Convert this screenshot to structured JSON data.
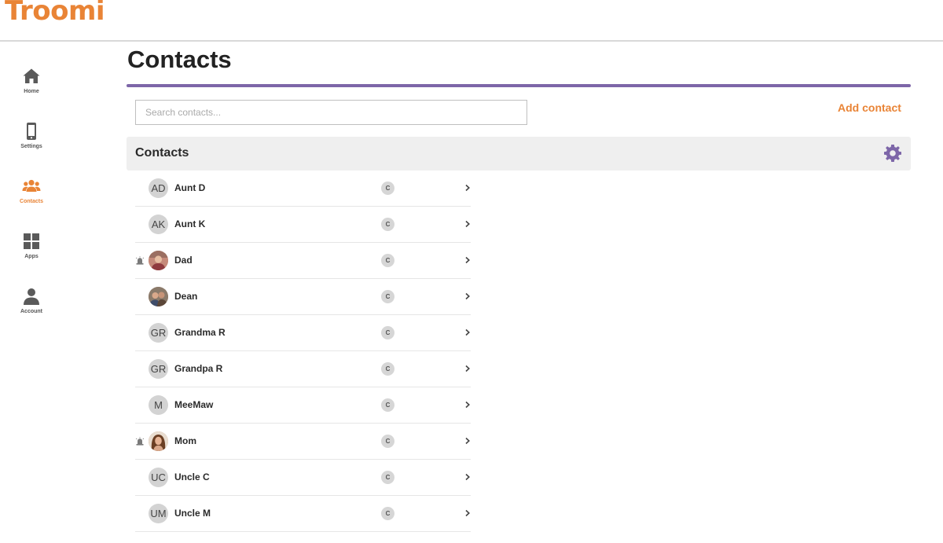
{
  "app": {
    "logo_text": "Troomi",
    "logo_mark": "™",
    "brand_color": "#e98436",
    "accent_color": "#7d66a8"
  },
  "sidebar": {
    "items": [
      {
        "label": "Home",
        "icon": "home-icon",
        "active": false
      },
      {
        "label": "Settings",
        "icon": "phone-icon",
        "active": false
      },
      {
        "label": "Contacts",
        "icon": "users-icon",
        "active": true
      },
      {
        "label": "Apps",
        "icon": "grid-icon",
        "active": false
      },
      {
        "label": "Account",
        "icon": "user-icon",
        "active": false
      }
    ]
  },
  "page": {
    "title": "Contacts",
    "search_placeholder": "Search contacts...",
    "search_value": "",
    "add_contact_label": "Add contact",
    "section_title": "Contacts",
    "settings_icon": "gear-icon"
  },
  "contacts": [
    {
      "name": "Aunt D",
      "initials": "AD",
      "photo": false,
      "alert": false,
      "badge": "C"
    },
    {
      "name": "Aunt K",
      "initials": "AK",
      "photo": false,
      "alert": false,
      "badge": "C"
    },
    {
      "name": "Dad",
      "initials": "",
      "photo": true,
      "alert": true,
      "badge": "C"
    },
    {
      "name": "Dean",
      "initials": "",
      "photo": true,
      "alert": false,
      "badge": "C"
    },
    {
      "name": "Grandma R",
      "initials": "GR",
      "photo": false,
      "alert": false,
      "badge": "C"
    },
    {
      "name": "Grandpa R",
      "initials": "GR",
      "photo": false,
      "alert": false,
      "badge": "C"
    },
    {
      "name": "MeeMaw",
      "initials": "M",
      "photo": false,
      "alert": false,
      "badge": "C"
    },
    {
      "name": "Mom",
      "initials": "",
      "photo": true,
      "alert": true,
      "badge": "C"
    },
    {
      "name": "Uncle C",
      "initials": "UC",
      "photo": false,
      "alert": false,
      "badge": "C"
    },
    {
      "name": "Uncle M",
      "initials": "UM",
      "photo": false,
      "alert": false,
      "badge": "C"
    }
  ]
}
